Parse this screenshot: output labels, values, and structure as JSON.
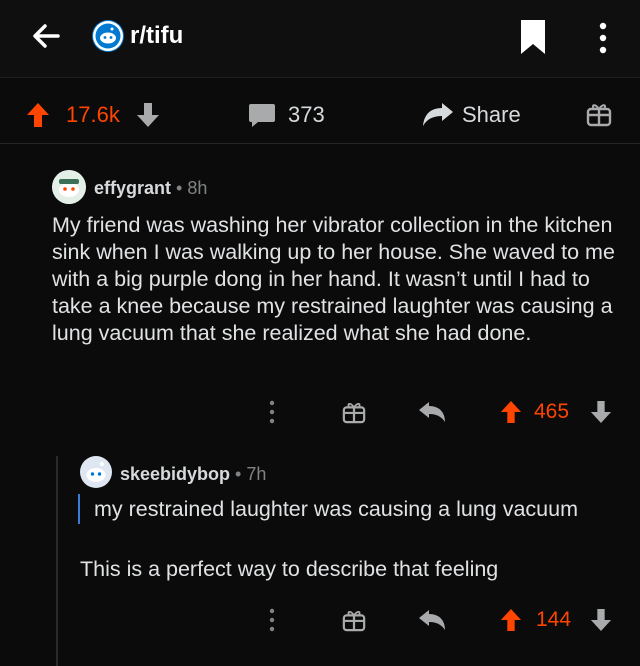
{
  "header": {
    "subreddit": "r/tifu"
  },
  "post_actions": {
    "score": "17.6k",
    "comments": "373",
    "share_label": "Share"
  },
  "comments": [
    {
      "author": "effygrant",
      "separator": "•",
      "age": "8h",
      "body": "My friend was washing her vibrator collection in the kitchen sink when I was walking up to her house. She waved to me with a big purple dong in her hand. It wasn’t until I had to take a knee because my restrained laughter was causing a lung vacuum that she realized what she had done.",
      "score": "465"
    },
    {
      "author": "skeebidybop",
      "separator": "•",
      "age": "7h",
      "quote": "my restrained laughter was causing a lung vacuum",
      "body": "This is a perfect way to describe that feeling",
      "score": "144"
    }
  ],
  "colors": {
    "background": "#0b0b0b",
    "upvote": "#ff4500",
    "text": "#d7dadc",
    "muted": "#818384",
    "quote_bar": "#3a7bd5"
  }
}
